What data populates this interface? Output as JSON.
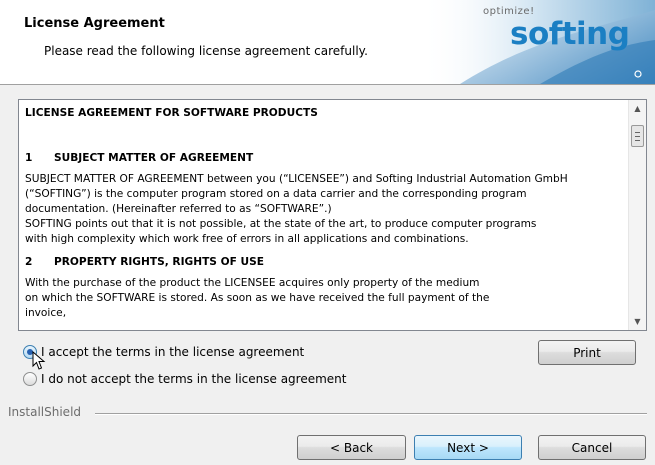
{
  "header": {
    "title": "License Agreement",
    "subtitle": "Please read the following license agreement carefully.",
    "logo_tagline": "optimize!",
    "logo_text": "softing"
  },
  "license": {
    "title": "LICENSE AGREEMENT FOR SOFTWARE PRODUCTS",
    "section1_number": "1",
    "section1_heading": "SUBJECT MATTER OF AGREEMENT",
    "section1_lines": [
      "SUBJECT MATTER OF AGREEMENT between you (“LICENSEE”) and Softing Industrial Automation GmbH",
      "(“SOFTING”) is the computer program stored on a data carrier and the corresponding program",
      "documentation. (Hereinafter referred to as “SOFTWARE”.)",
      "SOFTING points out that it is not possible, at the state of the art, to produce computer programs",
      "with high complexity which work free of errors in all applications and combinations."
    ],
    "section2_number": "2",
    "section2_heading": "PROPERTY RIGHTS, RIGHTS OF USE",
    "section2_lines": [
      "With the purchase of the product the LICENSEE acquires only property of the medium",
      "on which the SOFTWARE is stored. As soon as we have received the full payment of the",
      "invoice,"
    ]
  },
  "options": {
    "accept_label": "I accept the terms in the license agreement",
    "decline_label": "I do not accept the terms in the license agreement",
    "selected": "accept"
  },
  "buttons": {
    "print": "Print",
    "back": "< Back",
    "next": "Next >",
    "cancel": "Cancel"
  },
  "footer": {
    "brand": "InstallShield"
  },
  "colors": {
    "logo_blue": "#1b7fc3",
    "dialog_bg": "#f0f0f0"
  }
}
